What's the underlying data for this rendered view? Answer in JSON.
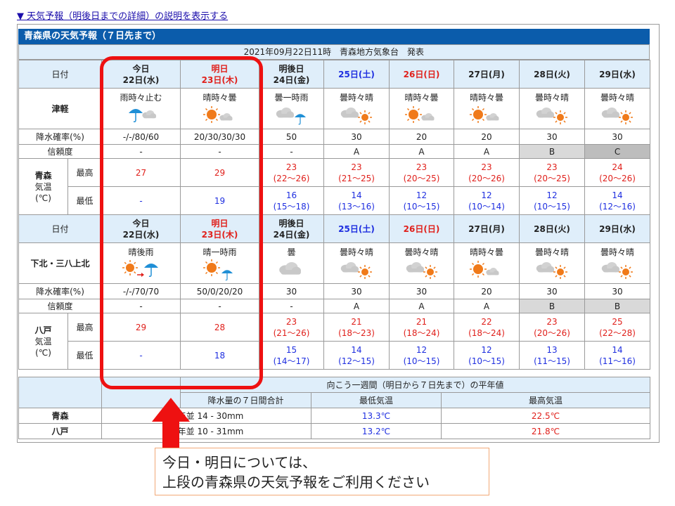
{
  "top_link": "▼ 天気予報（明後日までの詳細）の説明を表示する",
  "title": "青森県の天気予報（７日先まで）",
  "issued": "2021年09月22日11時　青森地方気象台　発表",
  "labels": {
    "date": "日付",
    "rain": "降水確率(%)",
    "reliability": "信頼度",
    "max": "最高",
    "min": "最低",
    "kion1": "気温",
    "kion2": "(℃)"
  },
  "days": [
    {
      "l1": "今日",
      "l2": "22日(水)",
      "color": "black"
    },
    {
      "l1": "明日",
      "l2": "23日(木)",
      "color": "red"
    },
    {
      "l1": "明後日",
      "l2": "24日(金)",
      "color": "black"
    },
    {
      "l1": "25日(土)",
      "l2": "",
      "color": "blue"
    },
    {
      "l1": "26日(日)",
      "l2": "",
      "color": "red"
    },
    {
      "l1": "27日(月)",
      "l2": "",
      "color": "black"
    },
    {
      "l1": "28日(火)",
      "l2": "",
      "color": "black"
    },
    {
      "l1": "29日(水)",
      "l2": "",
      "color": "black"
    }
  ],
  "areas": [
    {
      "name": "津軽",
      "weather": [
        "雨時々止む",
        "晴時々曇",
        "曇一時雨",
        "曇時々晴",
        "晴時々曇",
        "晴時々曇",
        "曇時々晴",
        "曇時々晴"
      ],
      "icons": [
        "umbrella-cloud",
        "sun-cloud",
        "cloud-umbrella",
        "cloud-sun",
        "sun-cloud",
        "sun-cloud",
        "cloud-sun",
        "cloud-sun"
      ],
      "rain": [
        "-/-/80/60",
        "20/30/30/30",
        "50",
        "30",
        "20",
        "20",
        "30",
        "30"
      ],
      "reliability": [
        "-",
        "-",
        "-",
        "A",
        "A",
        "A",
        "B",
        "C"
      ],
      "city": "青森",
      "max": [
        [
          "27",
          ""
        ],
        [
          "29",
          ""
        ],
        [
          "23",
          "(22～26)"
        ],
        [
          "23",
          "(21～25)"
        ],
        [
          "23",
          "(20～25)"
        ],
        [
          "23",
          "(20～26)"
        ],
        [
          "23",
          "(20～25)"
        ],
        [
          "24",
          "(20～26)"
        ]
      ],
      "min": [
        [
          "-",
          ""
        ],
        [
          "19",
          ""
        ],
        [
          "16",
          "(15～18)"
        ],
        [
          "14",
          "(13～16)"
        ],
        [
          "12",
          "(10～15)"
        ],
        [
          "12",
          "(10～14)"
        ],
        [
          "12",
          "(10～15)"
        ],
        [
          "14",
          "(12～16)"
        ]
      ]
    },
    {
      "name": "下北・三八上北",
      "weather": [
        "晴後雨",
        "晴一時雨",
        "曇",
        "曇時々晴",
        "曇時々晴",
        "晴時々曇",
        "曇時々晴",
        "曇時々晴"
      ],
      "icons": [
        "sun-later-umbrella",
        "sun-umbrella",
        "cloud",
        "cloud-sun",
        "cloud-sun",
        "sun-cloud",
        "cloud-sun",
        "cloud-sun"
      ],
      "rain": [
        "-/-/70/70",
        "50/0/20/20",
        "30",
        "30",
        "30",
        "20",
        "30",
        "30"
      ],
      "reliability": [
        "-",
        "-",
        "-",
        "A",
        "A",
        "A",
        "B",
        "B"
      ],
      "city": "八戸",
      "max": [
        [
          "29",
          ""
        ],
        [
          "28",
          ""
        ],
        [
          "23",
          "(21～26)"
        ],
        [
          "21",
          "(18～23)"
        ],
        [
          "21",
          "(18～24)"
        ],
        [
          "22",
          "(18～24)"
        ],
        [
          "23",
          "(20～26)"
        ],
        [
          "25",
          "(22～28)"
        ]
      ],
      "min": [
        [
          "-",
          ""
        ],
        [
          "18",
          ""
        ],
        [
          "15",
          "(14～17)"
        ],
        [
          "14",
          "(12～15)"
        ],
        [
          "12",
          "(10～15)"
        ],
        [
          "12",
          "(10～15)"
        ],
        [
          "13",
          "(11～15)"
        ],
        [
          "14",
          "(11～16)"
        ]
      ]
    }
  ],
  "normals": {
    "header": "向こう一週間（明日から７日先まで）の平年値",
    "cols": [
      "降水量の７日間合計",
      "最低気温",
      "最高気温"
    ],
    "rows": [
      {
        "city": "青森",
        "precip": "平年並 14 - 30mm",
        "min": "13.3℃",
        "max": "22.5℃"
      },
      {
        "city": "八戸",
        "precip": "平年並 10 - 31mm",
        "min": "13.2℃",
        "max": "21.8℃"
      }
    ]
  },
  "note_line1": "今日・明日については、",
  "note_line2": "上段の青森県の天気予報をご利用ください",
  "colors": {
    "title_bg": "#0b5cab",
    "header_bg": "#dfeefa",
    "highlight": "#ee1111",
    "rel_b": "#d9d9d9",
    "rel_c": "#bdbdbd"
  }
}
